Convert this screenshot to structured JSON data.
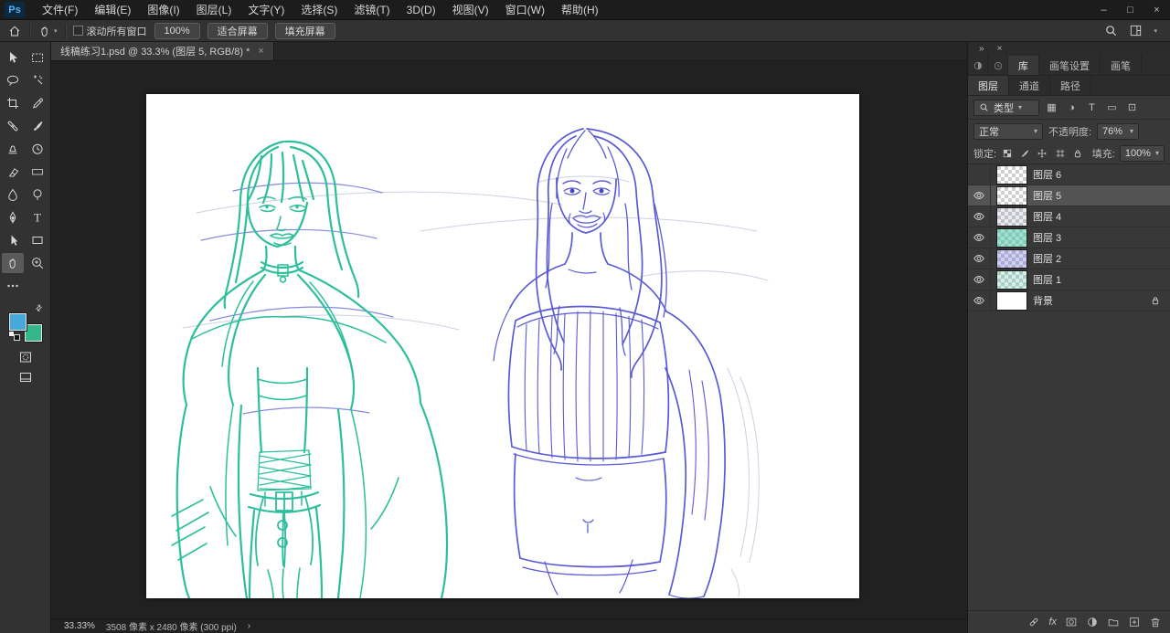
{
  "app": {
    "logo": "Ps",
    "window_controls": {
      "minimize": "–",
      "maximize": "□",
      "close": "×"
    }
  },
  "menubar": {
    "items": [
      "文件(F)",
      "编辑(E)",
      "图像(I)",
      "图层(L)",
      "文字(Y)",
      "选择(S)",
      "滤镜(T)",
      "3D(D)",
      "视图(V)",
      "窗口(W)",
      "帮助(H)"
    ]
  },
  "options_bar": {
    "scroll_all_windows_label": "滚动所有窗口",
    "zoom_100_label": "100%",
    "fit_screen_label": "适合屏幕",
    "fill_screen_label": "填充屏幕"
  },
  "document": {
    "tab_title": "线稿练习1.psd @ 33.3% (图层 5, RGB/8) *"
  },
  "toolbar": {
    "active_tool": "hand",
    "foreground_color": "#45a9da",
    "background_color": "#35b78c",
    "tools": [
      "move",
      "marquee",
      "lasso",
      "magic-wand",
      "crop",
      "eyedropper",
      "healing-brush",
      "brush",
      "clone-stamp",
      "history-brush",
      "eraser",
      "gradient",
      "blur",
      "dodge",
      "pen",
      "type",
      "path-selection",
      "shape",
      "hand",
      "zoom",
      "more"
    ]
  },
  "right_dock": {
    "top_tabs": [
      "库",
      "画笔设置",
      "画笔"
    ],
    "panel_tabs": [
      "图层",
      "通道",
      "路径"
    ],
    "layers_panel": {
      "filter_label": "类型",
      "blend_mode": "正常",
      "opacity_label": "不透明度:",
      "opacity_value": "76%",
      "lock_label": "锁定:",
      "fill_label": "填充:",
      "fill_value": "100%",
      "layers": [
        {
          "name": "图层 6",
          "visible": false,
          "selected": false
        },
        {
          "name": "图层 5",
          "visible": true,
          "selected": true
        },
        {
          "name": "图层 4",
          "visible": true,
          "selected": false
        },
        {
          "name": "图层 3",
          "visible": true,
          "selected": false
        },
        {
          "name": "图层 2",
          "visible": true,
          "selected": false
        },
        {
          "name": "图层 1",
          "visible": true,
          "selected": false
        },
        {
          "name": "背景",
          "visible": true,
          "selected": false,
          "locked": true
        }
      ]
    }
  },
  "status_bar": {
    "zoom_value": "33.33%",
    "document_info": "3508 像素 x 2480 像素 (300 ppi)"
  },
  "artwork": {
    "canvas_background": "#ffffff",
    "teal_color": "#2dbf9c",
    "blue_color": "#5a5ad6",
    "blue_pupil_color": "#4646c8",
    "construction_color": "#c7cbdf",
    "blue_overlay_color": "#6b6bd8"
  },
  "icons": {
    "chevron_down": "▾",
    "chevron_right": "›",
    "double_chevron": "»",
    "close": "×",
    "swap_arrows": "⇄",
    "filter_pixel": "▦",
    "filter_adjust": "◑",
    "filter_type": "T",
    "filter_shape": "▭",
    "filter_smart": "⊡",
    "fx": "fx"
  }
}
